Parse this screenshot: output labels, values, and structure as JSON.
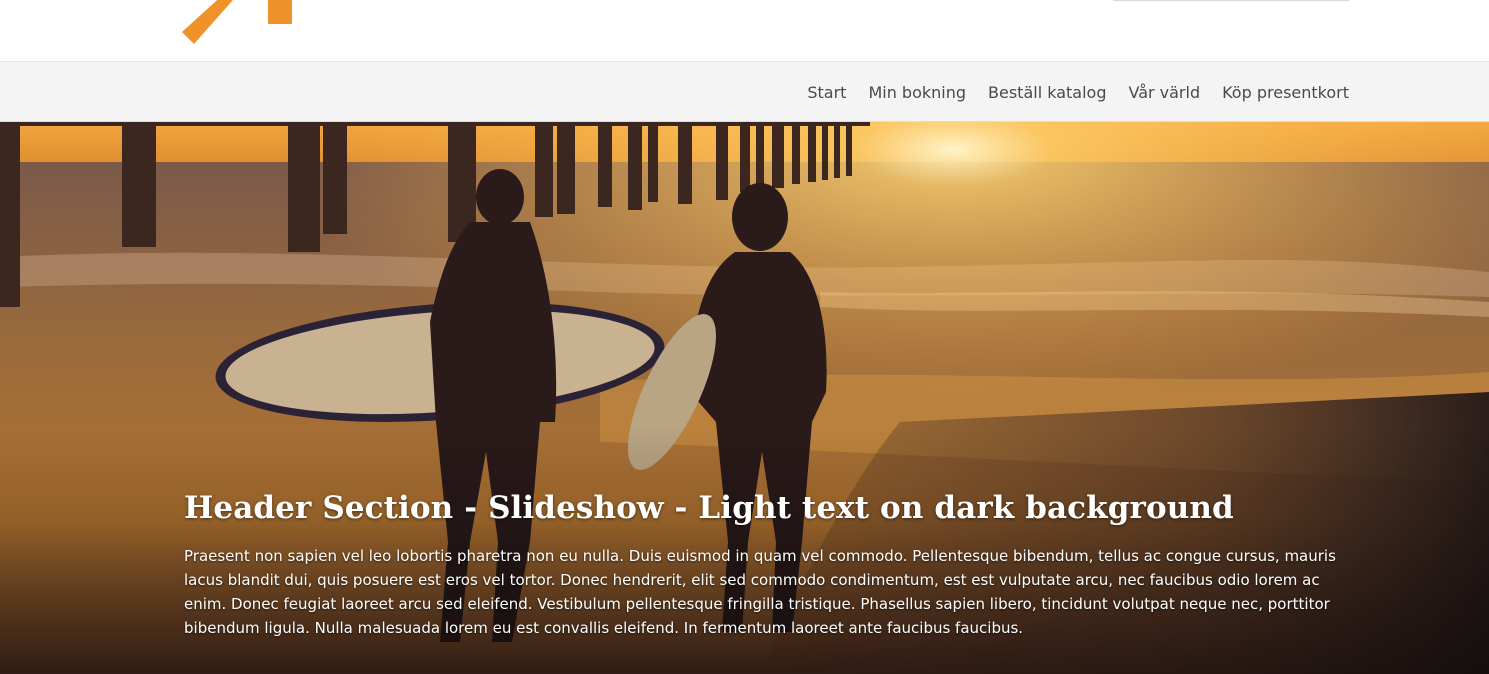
{
  "brand": {
    "logo_icon": "orange-arrow-logo",
    "accent_color": "#F0922A"
  },
  "nav": {
    "items": [
      {
        "label": "Start"
      },
      {
        "label": "Min bokning"
      },
      {
        "label": "Beställ katalog"
      },
      {
        "label": "Vår värld"
      },
      {
        "label": "Köp presentkort"
      }
    ]
  },
  "hero": {
    "title": "Header Section - Slideshow - Light text on dark background",
    "text": "Praesent non sapien vel leo lobortis pharetra non eu nulla. Duis euismod in quam vel commodo. Pellentesque bibendum, tellus ac congue cursus, mauris lacus blandit dui, quis posuere est eros vel tortor. Donec hendrerit, elit sed commodo condimentum, est est vulputate arcu, nec faucibus odio lorem ac enim. Donec feugiat laoreet arcu sed eleifend. Vestibulum pellentesque fringilla tristique. Phasellus sapien libero, tincidunt volutpat neque nec, porttitor bibendum ligula. Nulla malesuada lorem eu est convallis eleifend. In fermentum laoreet ante faucibus faucibus.",
    "image": "surfers-at-sunset-beach-photo"
  }
}
